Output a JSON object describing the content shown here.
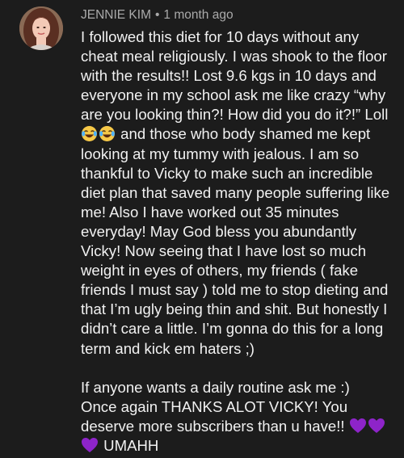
{
  "comment": {
    "author": "JENNIE KIM",
    "separator": "•",
    "timestamp": "1 month ago",
    "text_part1": "I followed this diet for 10 days without any cheat meal religiously. I was shook to the floor with the results!! Lost 9.6 kgs in 10 days and everyone in my school ask me like crazy “why are you looking thin?! How did you do it?!” Loll ",
    "text_part2": " and those who body shamed me kept looking at my tummy with jealous. I am so thankful to Vicky to make such an incredible diet plan that saved many people suffering like me! Also I have worked out 35 minutes everyday! May God bless you abundantly Vicky! Now seeing that I have lost so much weight in eyes of others, my friends ( fake friends I must say ) told me to stop dieting and that I’m ugly being thin and shit. But honestly I didn’t care a little. I’m gonna do this for a long term and kick em haters ;)\n\nIf anyone wants a daily routine ask me :)\nOnce again THANKS ALOT VICKY! You deserve more subscribers than u have!! ",
    "text_part3": " UMAHH",
    "laugh_emoji_icon": "face-with-tears-of-joy-icon",
    "heart_icon": "purple-heart-icon",
    "heart_color": "#8e24c9"
  }
}
